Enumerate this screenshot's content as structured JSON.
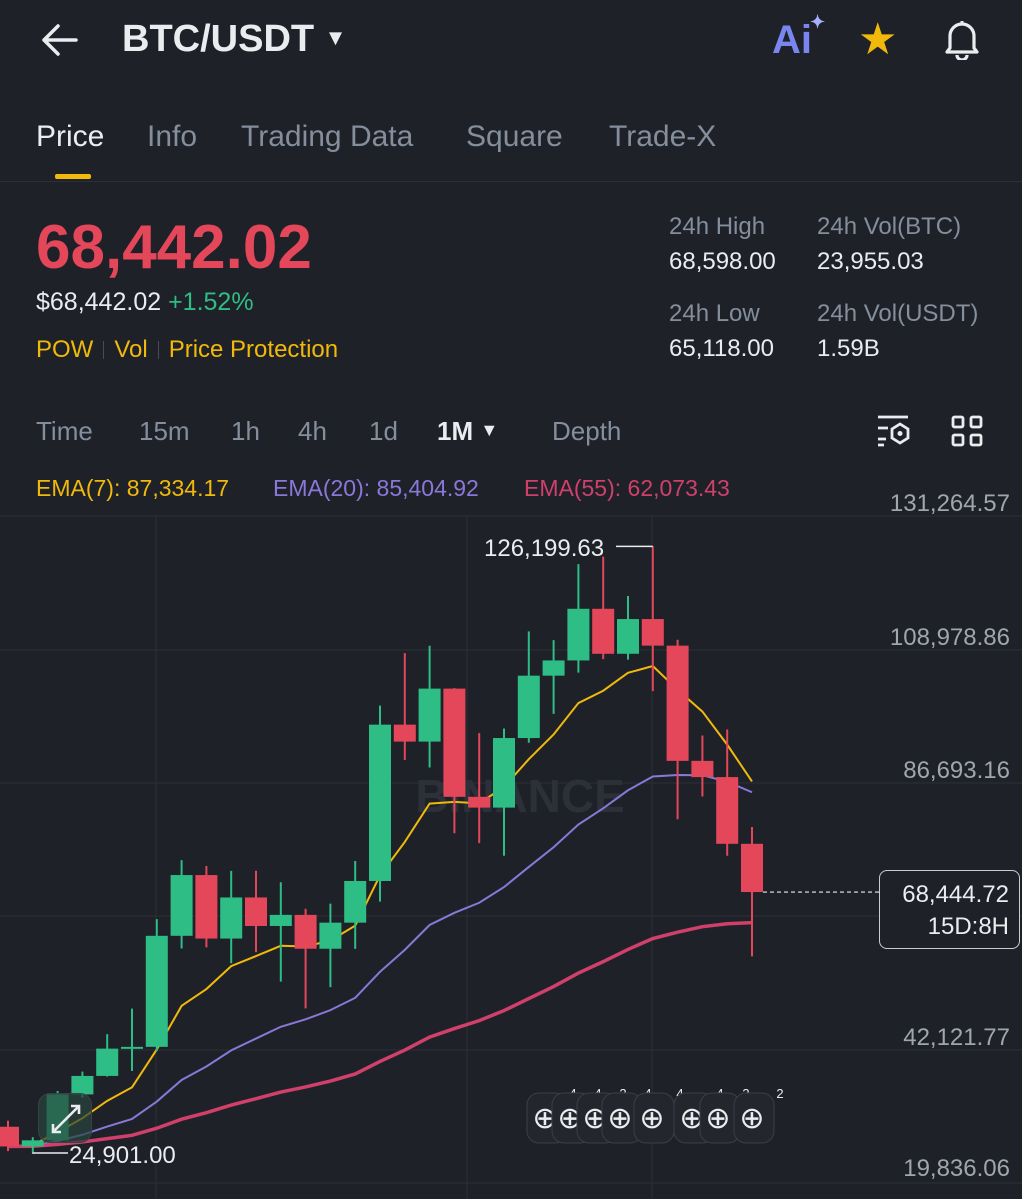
{
  "header": {
    "title": "BTC/USDT",
    "back_icon": "arrow-left-icon",
    "ai_label": "Ai",
    "star_icon": "star-icon",
    "bell_icon": "bell-icon"
  },
  "tabs": [
    {
      "label": "Price",
      "active": true
    },
    {
      "label": "Info"
    },
    {
      "label": "Trading Data"
    },
    {
      "label": "Square"
    },
    {
      "label": "Trade-X"
    }
  ],
  "price": {
    "last": "68,442.02",
    "usd": "$68,442.02",
    "change": "+1.52%",
    "tags": [
      "POW",
      "Vol",
      "Price Protection"
    ]
  },
  "stats": {
    "high_label": "24h High",
    "high": "68,598.00",
    "low_label": "24h Low",
    "low": "65,118.00",
    "vol_btc_label": "24h Vol(BTC)",
    "vol_btc": "23,955.03",
    "vol_usdt_label": "24h Vol(USDT)",
    "vol_usdt": "1.59B"
  },
  "intervals": [
    "Time",
    "15m",
    "1h",
    "4h",
    "1d",
    "1M",
    "Depth"
  ],
  "selected_interval": "1M",
  "ema": {
    "ema7": "EMA(7): 87,334.17",
    "ema20": "EMA(20): 85,404.92",
    "ema55": "EMA(55): 62,073.43"
  },
  "colors": {
    "up": "#2ebd85",
    "down": "#e4475a",
    "ema7": "#f0b90b",
    "ema20": "#8a78d8",
    "ema55": "#d0406a",
    "accent": "#f0b90b"
  },
  "watermark": "BINANCE",
  "chart_data": {
    "type": "candlestick",
    "y_ticks": [
      "131,264.57",
      "108,978.86",
      "86,693.16",
      "42,121.77",
      "19,836.06"
    ],
    "ylim": [
      19836.06,
      131264.57
    ],
    "max_label": "126,199.63",
    "min_label": "24,901.00",
    "current_price": "68,444.72",
    "countdown": "15D:8H",
    "ohlc": [
      [
        29232,
        30244,
        25166,
        25940
      ],
      [
        25940,
        27483,
        24901,
        26962
      ],
      [
        26962,
        35198,
        26538,
        34639
      ],
      [
        34639,
        38450,
        34097,
        37723
      ],
      [
        37723,
        44700,
        37615,
        42284
      ],
      [
        42284,
        48969,
        38555,
        42580
      ],
      [
        42580,
        63913,
        41884,
        61131
      ],
      [
        61131,
        73777,
        59005,
        71280
      ],
      [
        71280,
        72797,
        59191,
        60672
      ],
      [
        60672,
        71979,
        56552,
        67540
      ],
      [
        67540,
        71997,
        58402,
        62772
      ],
      [
        62772,
        70079,
        53485,
        64628
      ],
      [
        64628,
        65659,
        49000,
        58974
      ],
      [
        58974,
        66498,
        52550,
        63327
      ],
      [
        63327,
        73620,
        58946,
        70292
      ],
      [
        70292,
        99588,
        66835,
        96407
      ],
      [
        96407,
        108353,
        90500,
        93576
      ],
      [
        93576,
        109588,
        89256,
        102429
      ],
      [
        102429,
        102500,
        78258,
        84350
      ],
      [
        84350,
        95000,
        76606,
        82550
      ],
      [
        82550,
        95758,
        74508,
        94172
      ],
      [
        94172,
        111980,
        93377,
        104591
      ],
      [
        104591,
        110530,
        98200,
        107135
      ],
      [
        107135,
        123218,
        105100,
        115764
      ],
      [
        115764,
        124474,
        107350,
        108246
      ],
      [
        108246,
        117900,
        107270,
        114049
      ],
      [
        114049,
        126199.63,
        102000,
        109608
      ],
      [
        109608,
        110600,
        80600,
        90360
      ],
      [
        90360,
        94600,
        84400,
        87648
      ],
      [
        87648,
        95600,
        74500,
        76500
      ],
      [
        76500,
        79300,
        57700,
        68442
      ]
    ],
    "event_badges": [
      "4",
      "4",
      "2",
      "4",
      "4",
      "4",
      "3",
      "2"
    ]
  }
}
